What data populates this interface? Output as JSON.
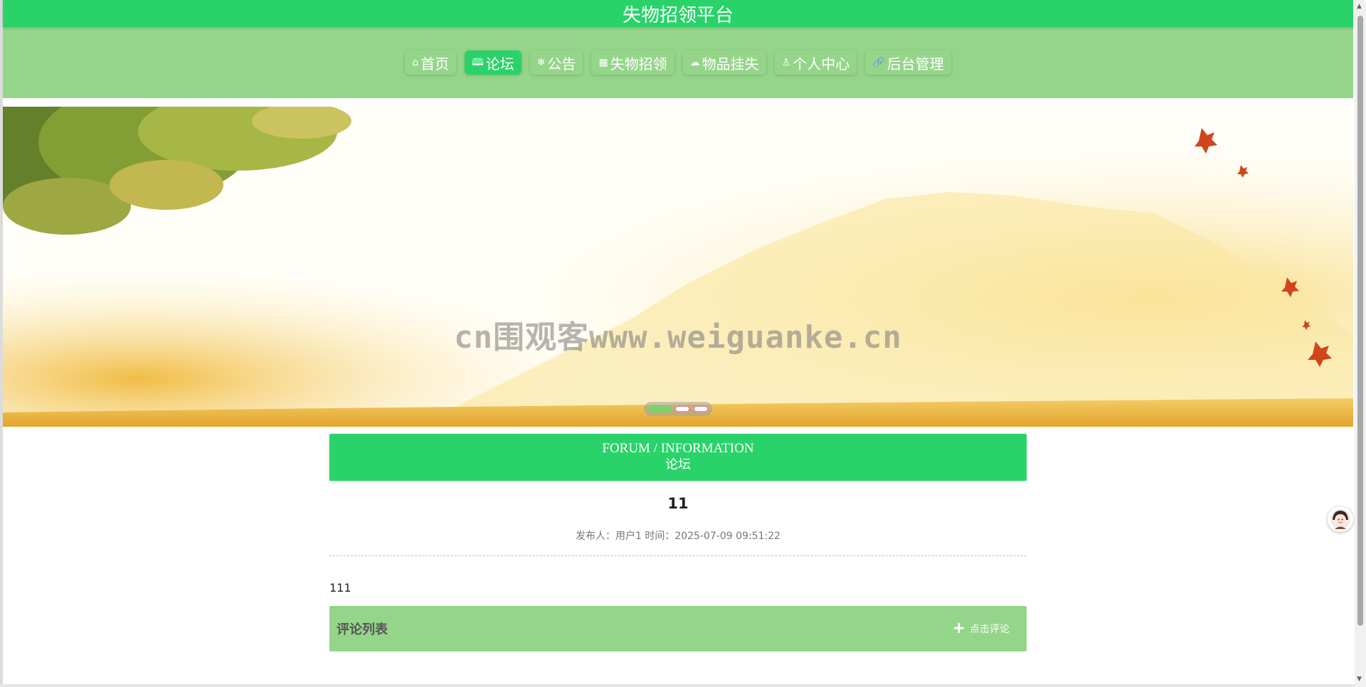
{
  "site": {
    "title": "失物招领平台"
  },
  "nav": {
    "items": [
      {
        "icon": "home-icon",
        "glyph": "⌂",
        "label": "首页",
        "active": false
      },
      {
        "icon": "forum-icon",
        "glyph": "🕮",
        "label": "论坛",
        "active": true
      },
      {
        "icon": "snowflake-icon",
        "glyph": "❄",
        "label": "公告",
        "active": false
      },
      {
        "icon": "image-icon",
        "glyph": "▦",
        "label": "失物招领",
        "active": false
      },
      {
        "icon": "cloud-icon",
        "glyph": "☁",
        "label": "物品挂失",
        "active": false
      },
      {
        "icon": "person-icon",
        "glyph": "♙",
        "label": "个人中心",
        "active": false
      },
      {
        "icon": "link-icon",
        "glyph": "🔗",
        "label": "后台管理",
        "active": false
      }
    ]
  },
  "banner": {
    "watermark": "cn围观客www.weiguanke.cn",
    "slides": 3,
    "active_slide": 1
  },
  "section": {
    "title_en": "FORUM / INFORMATION",
    "title_cn": "论坛"
  },
  "post": {
    "title": "11",
    "meta": "发布人：用户1 时间：2025-07-09 09:51:22",
    "content": "111"
  },
  "comments": {
    "title": "评论列表",
    "add_label": "点击评论"
  },
  "colors": {
    "primary": "#2ad36a",
    "secondary": "#95d58a"
  }
}
